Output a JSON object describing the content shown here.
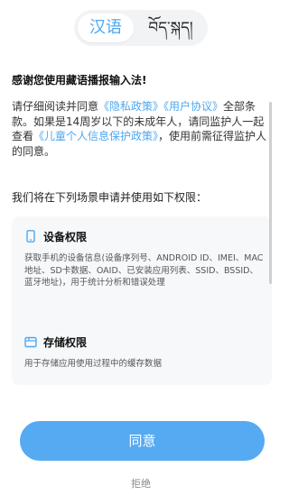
{
  "language_toggle": {
    "options": [
      "汉语",
      "བོད་སྐད།"
    ],
    "selected": "汉语"
  },
  "greeting": "感谢您使用藏语播报输入法!",
  "intro": {
    "part1": "请仔细阅读并同意",
    "privacy_link": "《隐私政策》",
    "agreement_link": "《用户协议》",
    "part2": "全部条款。如果是14周岁以下的未成年人，请同监护人一起查看",
    "children_link": "《儿童个人信息保护政策》",
    "part3": "，使用前需征得监护人的同意。"
  },
  "permissions_heading": "我们将在下列场景申请并使用如下权限：",
  "permissions": {
    "device": {
      "title": "设备权限",
      "icon": "phone-icon",
      "description": "获取手机的设备信息(设备序列号、ANDROID ID、IMEI、MAC地址、SD卡数据、OAID、已安装应用列表、SSID、BSSID、蓝牙地址)，用于统计分析和错误处理"
    },
    "storage": {
      "title": "存储权限",
      "icon": "folder-icon",
      "description": "用于存储应用使用过程中的缓存数据"
    }
  },
  "buttons": {
    "agree": "同意",
    "reject": "拒绝"
  },
  "colors": {
    "accent": "#55aaf2",
    "link": "#4ea7f1",
    "card_bg": "#f7f8fa"
  }
}
